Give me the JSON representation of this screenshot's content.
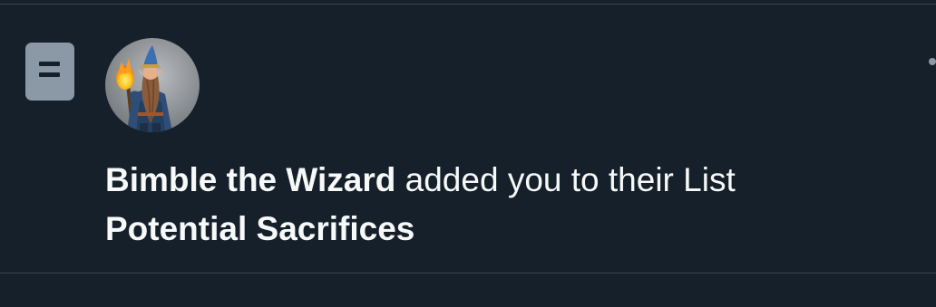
{
  "notification": {
    "actor_name": "Bimble the Wizard",
    "action_text": " added you to their List",
    "list_name": "Potential Sacrifices",
    "type_icon": "list-icon",
    "avatar_icon": "wizard-avatar"
  },
  "colors": {
    "background": "#15202b",
    "divider": "#38444d",
    "text": "#f7f9f9",
    "icon_bg": "#8b98a5"
  }
}
